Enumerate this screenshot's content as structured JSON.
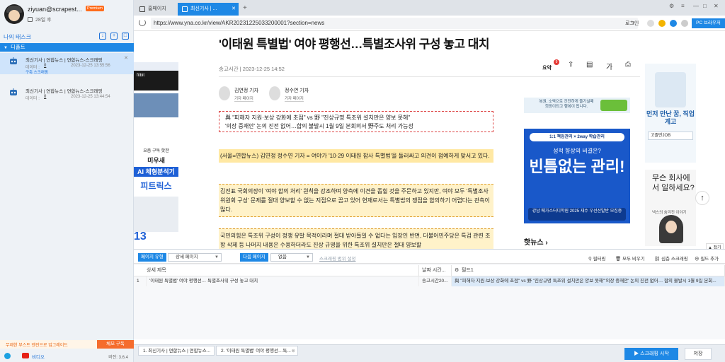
{
  "profile": {
    "username": "ziyuan@scrapest...",
    "badge": "Premium",
    "days_left": "28일 후"
  },
  "sidebar": {
    "my_tasks_label": "나의 태스크",
    "folder_label": "디폴트",
    "tasks": [
      {
        "name": "최신기사 | 연합뉴스 | 연합뉴스-스크래핑",
        "data_label": "데이터 :",
        "count": "0",
        "date": "2023-12-25 13:55:56",
        "status": "구축 스크래핑"
      },
      {
        "name": "최신기사 | 연합뉴스 | 연합뉴스-스크래핑",
        "data_label": "데이터 :",
        "count": "0",
        "date": "2023-12-25 13:44:54"
      }
    ],
    "upgrade_text": "무제한 부스트 엔진으로 업그레이드",
    "upgrade_button": "체모 구독",
    "video_label": "비디오",
    "version": "버전: 3.6.4"
  },
  "browser": {
    "tabs": [
      {
        "label": "홈페이지"
      },
      {
        "label": "최신기사 | ..."
      }
    ],
    "url": "https://www.yna.co.kr/view/AKR20231225033200001?section=news",
    "login_label": "로그인",
    "pc_browser_label": "PC 브라우저",
    "collapse_label": "접기"
  },
  "article": {
    "headline": "'이태원 특별법' 여야 평행선…특별조사위 구성 놓고 대치",
    "sent_time": "송고시간 | 2023-12-25 14:52",
    "summary_label": "요약",
    "reporters": [
      {
        "name": "김연정 기자",
        "page": "기자 페이지"
      },
      {
        "name": "정수연 기자",
        "page": "기자 페이지"
      }
    ],
    "subheads": [
      "與 \"피해자 지원·보상 강화에 초점\" vs 野 \"진상규명 특조위 설치만은 양보 못해\"",
      "'의장 중재안' 논의 진전 없어…합의 불발시 1월 9일 본회의서 野주도 처리 가능성"
    ],
    "paragraphs": [
      "(서울=연합뉴스) 김연정 정수연 기자 = 여야가 '10·29 이태원 참사 특별법'을 둘러싸고 의견이 첨예하게 맞서고 있다.",
      "김진표 국회의장이 '여야 합의 처리' 원칙을 강조하며 양측에 이견을 좁힐 것을 주문하고 있지만, 여야 모두 '특별조사위원회 구성' 문제를 절대 양보할 수 없는 지점으로 꼽고 있어 현재로서는 특별법의 쟁점을 합의하기 어렵다는 관측이 많다.",
      "국민의힘은 특조위 구성이 정쟁 유발 목적이라며 절대 받아들일 수 없다는 입장인 반면, 더불어민주당은 특검 관련 조항 삭제 등 나머지 내용은 수용하더라도 진상 규명을 위한 특조위 설치만은 절대 양보할"
    ],
    "hot_news": "핫뉴스"
  },
  "ads": {
    "left_top": "fitbit",
    "left_a": "요즘 구독 핫한",
    "left_b": "미우새",
    "left_c": "AI 체형분석기",
    "left_d": "피트릭스",
    "left_e": "13",
    "mid_text": "복권, 소액으로 건전하게 즐기실때 희망이되고 행복이 됩니다.",
    "big_top": "1:1 책임관리 × 2way 학습관리",
    "big_q": "성적 향상의 비결은?",
    "big_main": "빈틈없는 관리!",
    "big_bar": "강남 메가스터디학원 2025 재수 우선선발반 모집중",
    "r1_title": "먼저 만난 꿈, 직업계고",
    "r1_sub": "고졸만JOB",
    "r2_title": "무슨 회사에서 일하세요?",
    "r2_sub": "넥스의 숨겨진 이야기"
  },
  "panel": {
    "page_type_label": "페이지 유형",
    "page_type_value": "상세 페이지",
    "next_page_label": "다음 페이지",
    "next_page_value": "없음",
    "scroll_setting": "스크래핑 범위 설정",
    "filter": "필터링",
    "clear_all": "모두 비우기",
    "deep_scrape": "심층 스크래핑",
    "add_field": "필드 추가",
    "columns": [
      "상세 제목",
      "날짜 시간...",
      "필드1"
    ],
    "rows": [
      {
        "index": "1",
        "title": "'이태원 특별법' 여야 평행선… 특별조사위 구성 놓고 대치",
        "datetime": "송고시간20...",
        "field1": "與 \"피해자 지원·보상 강화에 초점\" vs 野 \"진상규명 특조위 설치만은 양보 못해\"'의장 중재안' 논의 진전 없어… 합의 불발시 1월 9일 본회..."
      }
    ]
  },
  "bottom": {
    "tabs": [
      "1. 최신기사 | 연합뉴스 | 연합뉴스...",
      "2. '이태원 특별법' 여야 평행선…특..."
    ],
    "start_label": "▶ 스크래핑 시작",
    "save_label": "저장"
  }
}
